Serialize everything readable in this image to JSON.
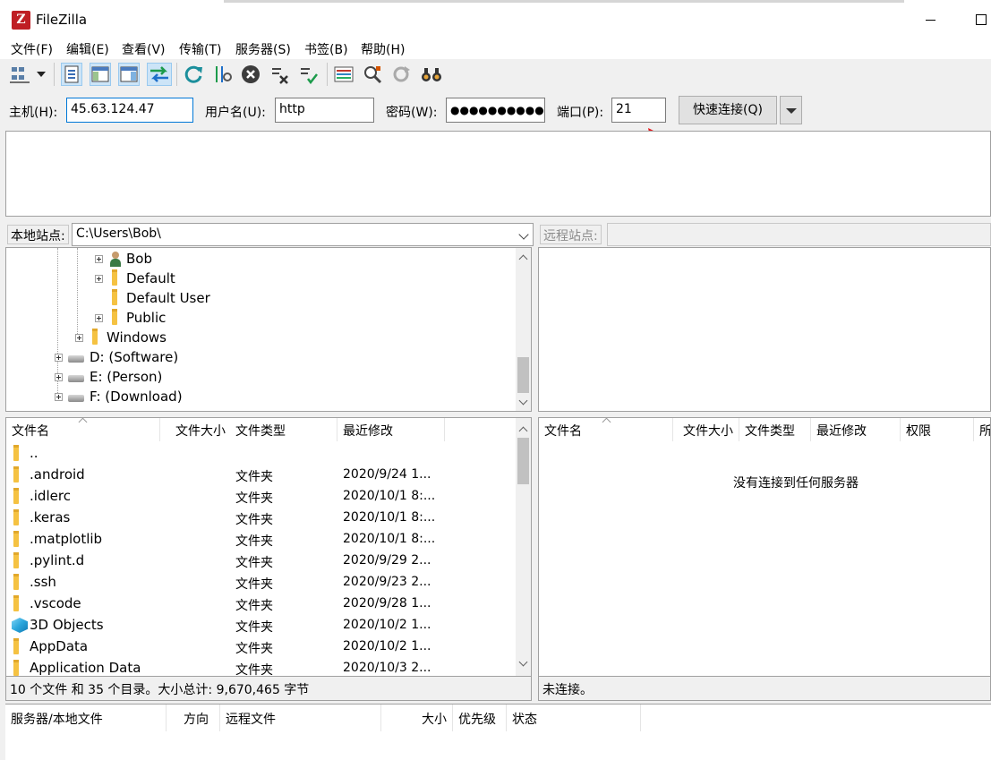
{
  "window": {
    "title": "FileZilla",
    "logo": "Z"
  },
  "menu": [
    "文件(F)",
    "编辑(E)",
    "查看(V)",
    "传输(T)",
    "服务器(S)",
    "书签(B)",
    "帮助(H)"
  ],
  "toolbar": {
    "icons": [
      "site-manager-icon",
      "dropdown-arrow-icon",
      "toggle-message-log-icon",
      "toggle-local-tree-icon",
      "toggle-remote-tree-icon",
      "toggle-transfer-queue-icon",
      "refresh-icon",
      "process-queue-icon",
      "cancel-operation-icon",
      "disconnect-icon",
      "reconnect-icon",
      "directory-comparison-icon",
      "filter-icon",
      "sync-browse-icon",
      "search-icon"
    ]
  },
  "quickconnect": {
    "host_label": "主机(H):",
    "host_value": "45.63.124.47",
    "user_label": "用户名(U):",
    "user_value": "http",
    "password_label": "密码(W):",
    "password_value": "●●●●●●●●●●",
    "port_label": "端口(P):",
    "port_value": "21",
    "connect_label": "快速连接(Q)"
  },
  "local_site": {
    "label": "本地站点:",
    "path": "C:\\Users\\Bob\\",
    "tree": [
      {
        "name": "Bob",
        "icon": "user-folder"
      },
      {
        "name": "Default",
        "icon": "folder"
      },
      {
        "name": "Default User",
        "icon": "folder"
      },
      {
        "name": "Public",
        "icon": "folder"
      },
      {
        "name": "Windows",
        "icon": "folder"
      },
      {
        "name": "D: (Software)",
        "icon": "drive"
      },
      {
        "name": "E: (Person)",
        "icon": "drive"
      },
      {
        "name": "F: (Download)",
        "icon": "drive"
      }
    ],
    "columns": [
      "文件名",
      "文件大小",
      "文件类型",
      "最近修改"
    ],
    "files": [
      {
        "name": "..",
        "type": "",
        "date": ""
      },
      {
        "name": ".android",
        "type": "文件夹",
        "date": "2020/9/24 1..."
      },
      {
        "name": ".idlerc",
        "type": "文件夹",
        "date": "2020/10/1 8:..."
      },
      {
        "name": ".keras",
        "type": "文件夹",
        "date": "2020/10/1 8:..."
      },
      {
        "name": ".matplotlib",
        "type": "文件夹",
        "date": "2020/10/1 8:..."
      },
      {
        "name": ".pylint.d",
        "type": "文件夹",
        "date": "2020/9/29 2..."
      },
      {
        "name": ".ssh",
        "type": "文件夹",
        "date": "2020/9/23 2..."
      },
      {
        "name": ".vscode",
        "type": "文件夹",
        "date": "2020/9/28 1..."
      },
      {
        "name": "3D Objects",
        "type": "文件夹",
        "date": "2020/10/2 1..."
      },
      {
        "name": "AppData",
        "type": "文件夹",
        "date": "2020/10/2 1..."
      },
      {
        "name": "Application Data",
        "type": "文件夹",
        "date": "2020/10/3 2..."
      }
    ],
    "status": "10 个文件 和 35 个目录。大小总计: 9,670,465 字节"
  },
  "remote_site": {
    "label": "远程站点:",
    "columns": [
      "文件名",
      "文件大小",
      "文件类型",
      "最近修改",
      "权限",
      "所"
    ],
    "empty_message": "没有连接到任何服务器",
    "status": "未连接。"
  },
  "queue": {
    "columns": [
      "服务器/本地文件",
      "方向",
      "远程文件",
      "大小",
      "优先级",
      "状态"
    ]
  },
  "colors": {
    "annotation_arrow": "#e8161b",
    "logo": "#bf1e24",
    "folder": "#f5c242"
  }
}
